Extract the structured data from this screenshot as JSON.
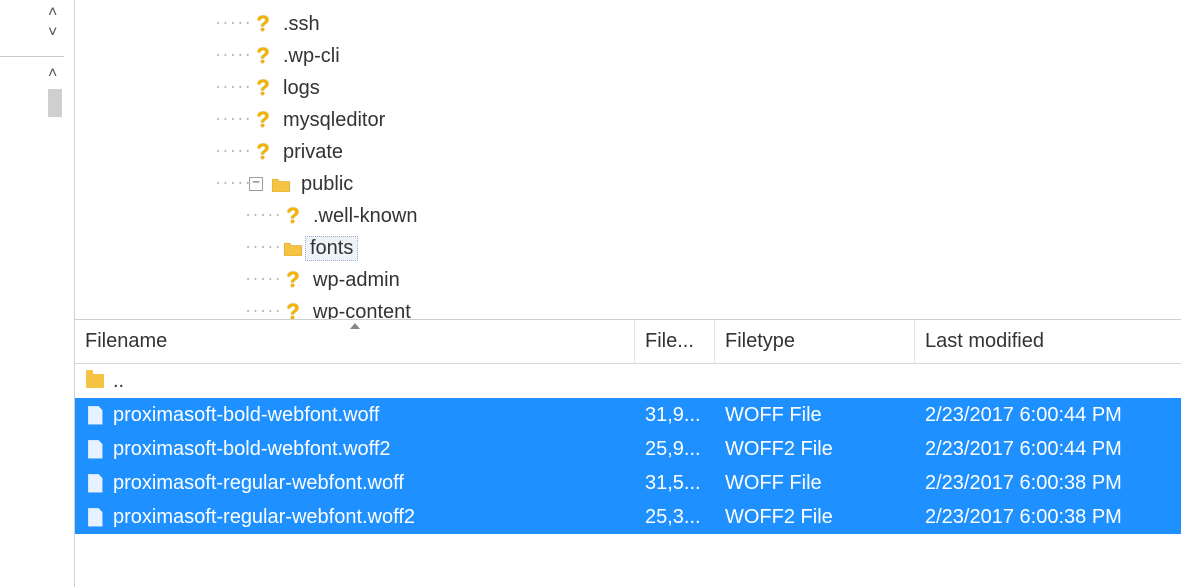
{
  "tree": {
    "items": [
      {
        "label": ".ssh",
        "icon": "question",
        "depth": 0
      },
      {
        "label": ".wp-cli",
        "icon": "question",
        "depth": 0
      },
      {
        "label": "logs",
        "icon": "question",
        "depth": 0
      },
      {
        "label": "mysqleditor",
        "icon": "question",
        "depth": 0
      },
      {
        "label": "private",
        "icon": "question",
        "depth": 0
      },
      {
        "label": "public",
        "icon": "folder",
        "depth": 0,
        "expandable": true,
        "expanded": true
      },
      {
        "label": ".well-known",
        "icon": "question",
        "depth": 1
      },
      {
        "label": "fonts",
        "icon": "folder",
        "depth": 1,
        "selected": true
      },
      {
        "label": "wp-admin",
        "icon": "question",
        "depth": 1
      },
      {
        "label": "wp-content",
        "icon": "question",
        "depth": 1
      }
    ]
  },
  "list": {
    "columns": {
      "name": "Filename",
      "size": "File...",
      "type": "Filetype",
      "modified": "Last modified"
    },
    "updir_label": "..",
    "rows": [
      {
        "name": "proximasoft-bold-webfont.woff",
        "size": "31,9...",
        "type": "WOFF File",
        "modified": "2/23/2017 6:00:44 PM",
        "selected": true
      },
      {
        "name": "proximasoft-bold-webfont.woff2",
        "size": "25,9...",
        "type": "WOFF2 File",
        "modified": "2/23/2017 6:00:44 PM",
        "selected": true
      },
      {
        "name": "proximasoft-regular-webfont.woff",
        "size": "31,5...",
        "type": "WOFF File",
        "modified": "2/23/2017 6:00:38 PM",
        "selected": true
      },
      {
        "name": "proximasoft-regular-webfont.woff2",
        "size": "25,3...",
        "type": "WOFF2 File",
        "modified": "2/23/2017 6:00:38 PM",
        "selected": true
      }
    ]
  }
}
